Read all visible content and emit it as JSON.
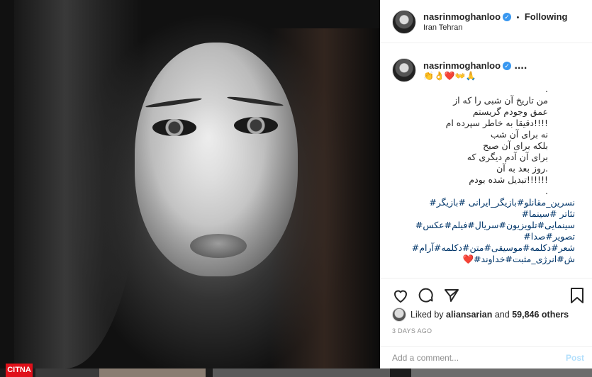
{
  "header": {
    "username": "nasrinmoghanloo",
    "separator": "•",
    "follow_status": "Following",
    "location": "Iran Tehran"
  },
  "caption": {
    "username": "nasrinmoghanloo",
    "emoji_line": "👏👌❤️👐🙏",
    "more": "....",
    "lines": [
      ".",
      "من تاریخ آن شبی را که از",
      "عمق وجودم گریستم",
      "!!!!دقیقا به خاطر سپرده ام",
      "نه برای آن شب",
      "بلکه برای آن صبح",
      "برای آن آدم دیگری که",
      ".روز بعد به آن",
      "!!!!!!تبدیل شده بودم",
      "."
    ],
    "hashtags": [
      "نسرین_مقانلو#بازیگر_ایرانی #بازیگر#",
      "تئاتر #سینما#",
      "سینمایی#تلویزیون#سریال#فیلم#عکس#",
      "تصویر#صدا#",
      "شعر#دکلمه#موسیقی#متن#دکلمه#آرام#",
      "ش#انرژی_مثبت#خداوند#❤️"
    ]
  },
  "actions": {
    "like_icon": "heart-icon",
    "comment_icon": "comment-icon",
    "share_icon": "share-icon",
    "save_icon": "bookmark-icon"
  },
  "likes": {
    "prefix": "Liked by",
    "user": "aliansarian",
    "conjunction": "and",
    "others": "59,846 others"
  },
  "timestamp": "3 DAYS AGO",
  "comment": {
    "placeholder": "Add a comment...",
    "post_label": "Post"
  },
  "watermark": "CITNA"
}
